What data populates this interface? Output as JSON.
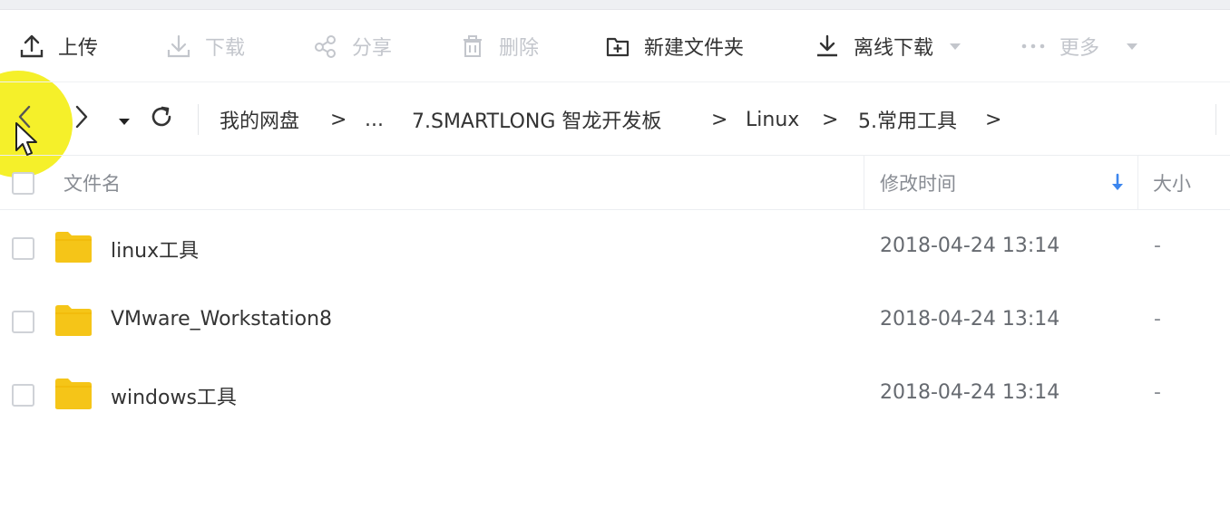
{
  "toolbar": {
    "upload": "上传",
    "download": "下载",
    "share": "分享",
    "delete": "删除",
    "new_folder": "新建文件夹",
    "offline_download": "离线下载",
    "more": "更多"
  },
  "breadcrumb": {
    "root": "我的网盘",
    "sep": ">",
    "ellipsis": "...",
    "items": [
      "7.SMARTLONG 智龙开发板",
      "Linux",
      "5.常用工具"
    ]
  },
  "columns": {
    "name": "文件名",
    "modified": "修改时间",
    "size": "大小"
  },
  "files": [
    {
      "name": "linux工具",
      "modified": "2018-04-24 13:14",
      "size": "-"
    },
    {
      "name": "VMware_Workstation8",
      "modified": "2018-04-24 13:14",
      "size": "-"
    },
    {
      "name": "windows工具",
      "modified": "2018-04-24 13:14",
      "size": "-"
    }
  ],
  "colors": {
    "folder": "#f5c518",
    "sort_arrow": "#3c86ee",
    "disabled": "#c3c6cc",
    "highlight": "#f4ef1f"
  },
  "icons": {
    "upload": "upload-icon",
    "download": "download-icon",
    "share": "share-icon",
    "delete": "trash-icon",
    "new_folder": "new-folder-icon",
    "offline_download": "offline-download-icon",
    "more": "more-dots-icon",
    "back": "back-arrow-icon",
    "forward": "forward-arrow-icon",
    "history": "history-dropdown-icon",
    "refresh": "refresh-icon",
    "sort": "sort-desc-icon",
    "folder": "folder-icon"
  }
}
